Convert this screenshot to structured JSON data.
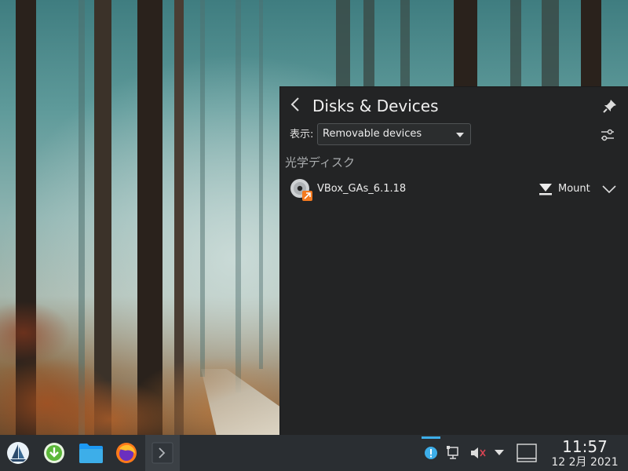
{
  "popup": {
    "title": "Disks & Devices",
    "filter_label": "表示:",
    "filter_selected": "Removable devices",
    "section_header": "光学ディスク",
    "devices": [
      {
        "name": "VBox_GAs_6.1.18",
        "action_label": "Mount",
        "icon": "optical-disc-icon"
      }
    ],
    "icons": {
      "back": "back-arrow-icon",
      "pin": "pin-icon",
      "settings": "settings-sliders-icon",
      "mount": "mount-icon",
      "expand": "chevron-down-icon"
    }
  },
  "taskbar": {
    "launchers": [
      {
        "name": "application-launcher",
        "icon": "sailboat-icon"
      },
      {
        "name": "software-center",
        "icon": "download-arrow-icon"
      },
      {
        "name": "file-manager",
        "icon": "folder-icon"
      },
      {
        "name": "firefox",
        "icon": "firefox-icon"
      },
      {
        "name": "konsole",
        "icon": "terminal-icon"
      }
    ],
    "tray": [
      "notification-icon",
      "network-icon",
      "volume-muted-icon",
      "expand-tray-icon"
    ],
    "clock_time": "11:57",
    "clock_date": "12 2月 2021"
  },
  "colors": {
    "accent": "#3daee9",
    "panel": "#2a2e32",
    "popup": "#232425"
  }
}
